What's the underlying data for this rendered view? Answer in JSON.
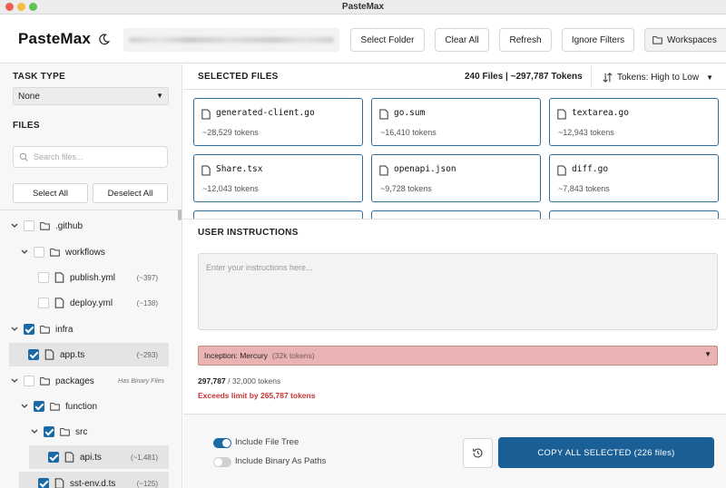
{
  "window": {
    "title": "PasteMax"
  },
  "header": {
    "brand": "PasteMax",
    "buttons": {
      "select_folder": "Select Folder",
      "clear_all": "Clear All",
      "refresh": "Refresh",
      "ignore_filters": "Ignore Filters",
      "workspaces": "Workspaces"
    }
  },
  "sidebar": {
    "task_type_label": "TASK TYPE",
    "task_type_value": "None",
    "files_label": "FILES",
    "search_placeholder": "Search files...",
    "select_all": "Select All",
    "deselect_all": "Deselect All",
    "tree": [
      {
        "name": ".github",
        "type": "folder",
        "expanded": true,
        "checked": false
      },
      {
        "name": "workflows",
        "type": "folder",
        "expanded": true,
        "checked": false
      },
      {
        "name": "publish.yml",
        "type": "file",
        "checked": false,
        "tokens": "(~397)"
      },
      {
        "name": "deploy.yml",
        "type": "file",
        "checked": false,
        "tokens": "(~138)"
      },
      {
        "name": "infra",
        "type": "folder",
        "expanded": true,
        "checked": true
      },
      {
        "name": "app.ts",
        "type": "file",
        "checked": true,
        "tokens": "(~293)"
      },
      {
        "name": "packages",
        "type": "folder",
        "expanded": true,
        "checked": false,
        "badge": "Has Binary Files"
      },
      {
        "name": "function",
        "type": "folder",
        "expanded": true,
        "checked": true
      },
      {
        "name": "src",
        "type": "folder",
        "expanded": true,
        "checked": true
      },
      {
        "name": "api.ts",
        "type": "file",
        "checked": true,
        "tokens": "(~1,481)"
      },
      {
        "name": "sst-env.d.ts",
        "type": "file",
        "checked": true,
        "tokens": "(~125)"
      }
    ]
  },
  "main": {
    "selected_title": "SELECTED FILES",
    "summary": "240 Files | ~297,787 Tokens",
    "sort_label": "Tokens: High to Low",
    "files": [
      {
        "name": "generated-client.go",
        "tokens": "~28,529 tokens"
      },
      {
        "name": "go.sum",
        "tokens": "~16,410 tokens"
      },
      {
        "name": "textarea.go",
        "tokens": "~12,943 tokens"
      },
      {
        "name": "Share.tsx",
        "tokens": "~12,043 tokens"
      },
      {
        "name": "openapi.json",
        "tokens": "~9,728 tokens"
      },
      {
        "name": "diff.go",
        "tokens": "~7,843 tokens"
      }
    ],
    "instructions_title": "USER INSTRUCTIONS",
    "instructions_placeholder": "Enter your instructions here...",
    "model_name": "Inception: Mercury",
    "model_tokens": "(32k tokens)",
    "usage_used": "297,787",
    "usage_limit": "/ 32,000 tokens",
    "exceeds": "Exceeds limit by 265,787 tokens",
    "include_file_tree": "Include File Tree",
    "include_file_tree_on": true,
    "include_binary": "Include Binary As Paths",
    "include_binary_on": false,
    "copy_button": "COPY ALL SELECTED (226 files)"
  },
  "colors": {
    "accent": "#1b5f97",
    "card_border": "#2f6f9f",
    "error_bg": "#eab3b3",
    "error_text": "#c43333"
  }
}
